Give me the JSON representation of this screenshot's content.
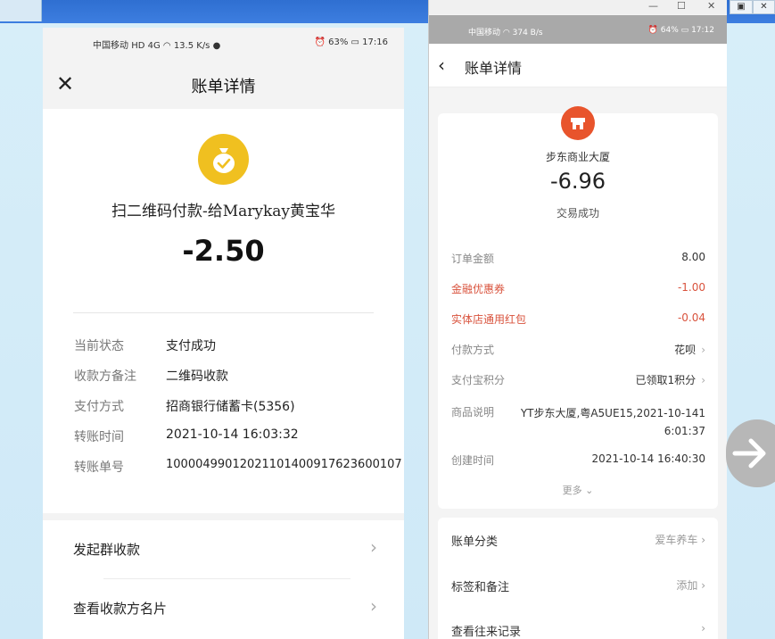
{
  "left_phone": {
    "status_bar": {
      "carrier": "中国移动",
      "network": "HD 4G",
      "speed": "13.5 K/s",
      "battery": "63%",
      "time": "17:16"
    },
    "title": "账单详情",
    "merchant": "扫二维码付款-给Marykay黄宝华",
    "amount": "-2.50",
    "details": [
      {
        "label": "当前状态",
        "value": "支付成功"
      },
      {
        "label": "收款方备注",
        "value": "二维码收款"
      },
      {
        "label": "支付方式",
        "value": "招商银行储蓄卡(5356)"
      },
      {
        "label": "转账时间",
        "value": "2021-10-14 16:03:32"
      },
      {
        "label": "转账单号",
        "value": "10000499012021101400917623600107"
      }
    ],
    "actions": [
      {
        "label": "发起群收款"
      },
      {
        "label": "查看收款方名片"
      }
    ]
  },
  "right_phone": {
    "window_controls": {
      "minimize": "—",
      "maximize": "☐",
      "close": "✕"
    },
    "status_bar": {
      "carrier": "中国移动",
      "speed": "374 B/s",
      "battery": "64%",
      "time": "17:12"
    },
    "title": "账单详情",
    "merchant": "步东商业大厦",
    "amount": "-6.96",
    "status": "交易成功",
    "details": [
      {
        "label": "订单金额",
        "value": "8.00",
        "type": "normal"
      },
      {
        "label": "金融优惠券",
        "value": "-1.00",
        "type": "red"
      },
      {
        "label": "实体店通用红包",
        "value": "-0.04",
        "type": "red"
      },
      {
        "label": "付款方式",
        "value": "花呗",
        "type": "link"
      },
      {
        "label": "支付宝积分",
        "value": "已领取1积分",
        "type": "link"
      },
      {
        "label": "商品说明",
        "value": "YT步东大厦,粤A5UE15,2021-10-1416:01:37",
        "type": "normal"
      },
      {
        "label": "创建时间",
        "value": "2021-10-14 16:40:30",
        "type": "normal"
      }
    ],
    "more": "更多",
    "extras": [
      {
        "label": "账单分类",
        "value": "爱车养车"
      },
      {
        "label": "标签和备注",
        "value": "添加"
      },
      {
        "label": "查看往来记录",
        "value": ""
      }
    ]
  },
  "colors": {
    "coin": "#f0c020",
    "store_icon": "#e8542c",
    "discount_red": "#d9533d"
  }
}
